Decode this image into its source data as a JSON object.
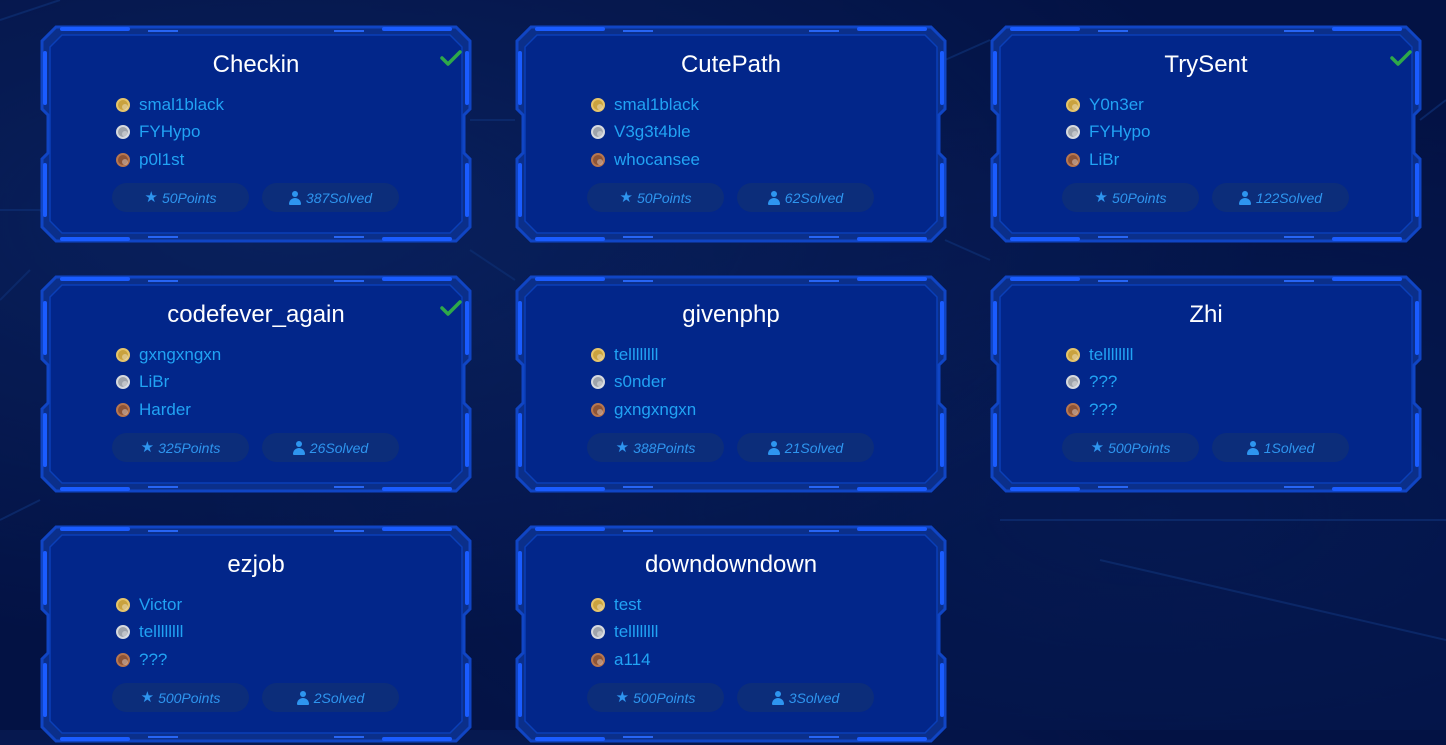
{
  "colors": {
    "background": "#031244",
    "card_fill": "#02268a",
    "frame_accent": "#1a5cff",
    "title": "#ffffff",
    "rank_name": "#21a3f4",
    "pill_text": "#2e95ef",
    "solved_check": "#2ea84a"
  },
  "icons": {
    "points": "star-icon",
    "solved": "user-icon",
    "first": "gold-medal-icon",
    "second": "silver-medal-icon",
    "third": "bronze-medal-icon",
    "solved_mark": "check-icon"
  },
  "challenges": [
    {
      "title": "Checkin",
      "solved_by_me": true,
      "ranks": [
        "smal1black",
        "FYHypo",
        "p0l1st"
      ],
      "points": "50Points",
      "solved": "387Solved"
    },
    {
      "title": "CutePath",
      "solved_by_me": false,
      "ranks": [
        "smal1black",
        "V3g3t4ble",
        "whocansee"
      ],
      "points": "50Points",
      "solved": "62Solved"
    },
    {
      "title": "TrySent",
      "solved_by_me": true,
      "ranks": [
        "Y0n3er",
        "FYHypo",
        "LiBr"
      ],
      "points": "50Points",
      "solved": "122Solved"
    },
    {
      "title": "codefever_again",
      "solved_by_me": true,
      "ranks": [
        "gxngxngxn",
        "LiBr",
        "Harder"
      ],
      "points": "325Points",
      "solved": "26Solved"
    },
    {
      "title": "givenphp",
      "solved_by_me": false,
      "ranks": [
        "tellllllll",
        "s0nder",
        "gxngxngxn"
      ],
      "points": "388Points",
      "solved": "21Solved"
    },
    {
      "title": "Zhi",
      "solved_by_me": false,
      "ranks": [
        "tellllllll",
        "???",
        "???"
      ],
      "points": "500Points",
      "solved": "1Solved"
    },
    {
      "title": "ezjob",
      "solved_by_me": false,
      "ranks": [
        "Victor",
        "tellllllll",
        "???"
      ],
      "points": "500Points",
      "solved": "2Solved"
    },
    {
      "title": "downdowndown",
      "solved_by_me": false,
      "ranks": [
        "test",
        "tellllllll",
        "a114"
      ],
      "points": "500Points",
      "solved": "3Solved"
    }
  ]
}
